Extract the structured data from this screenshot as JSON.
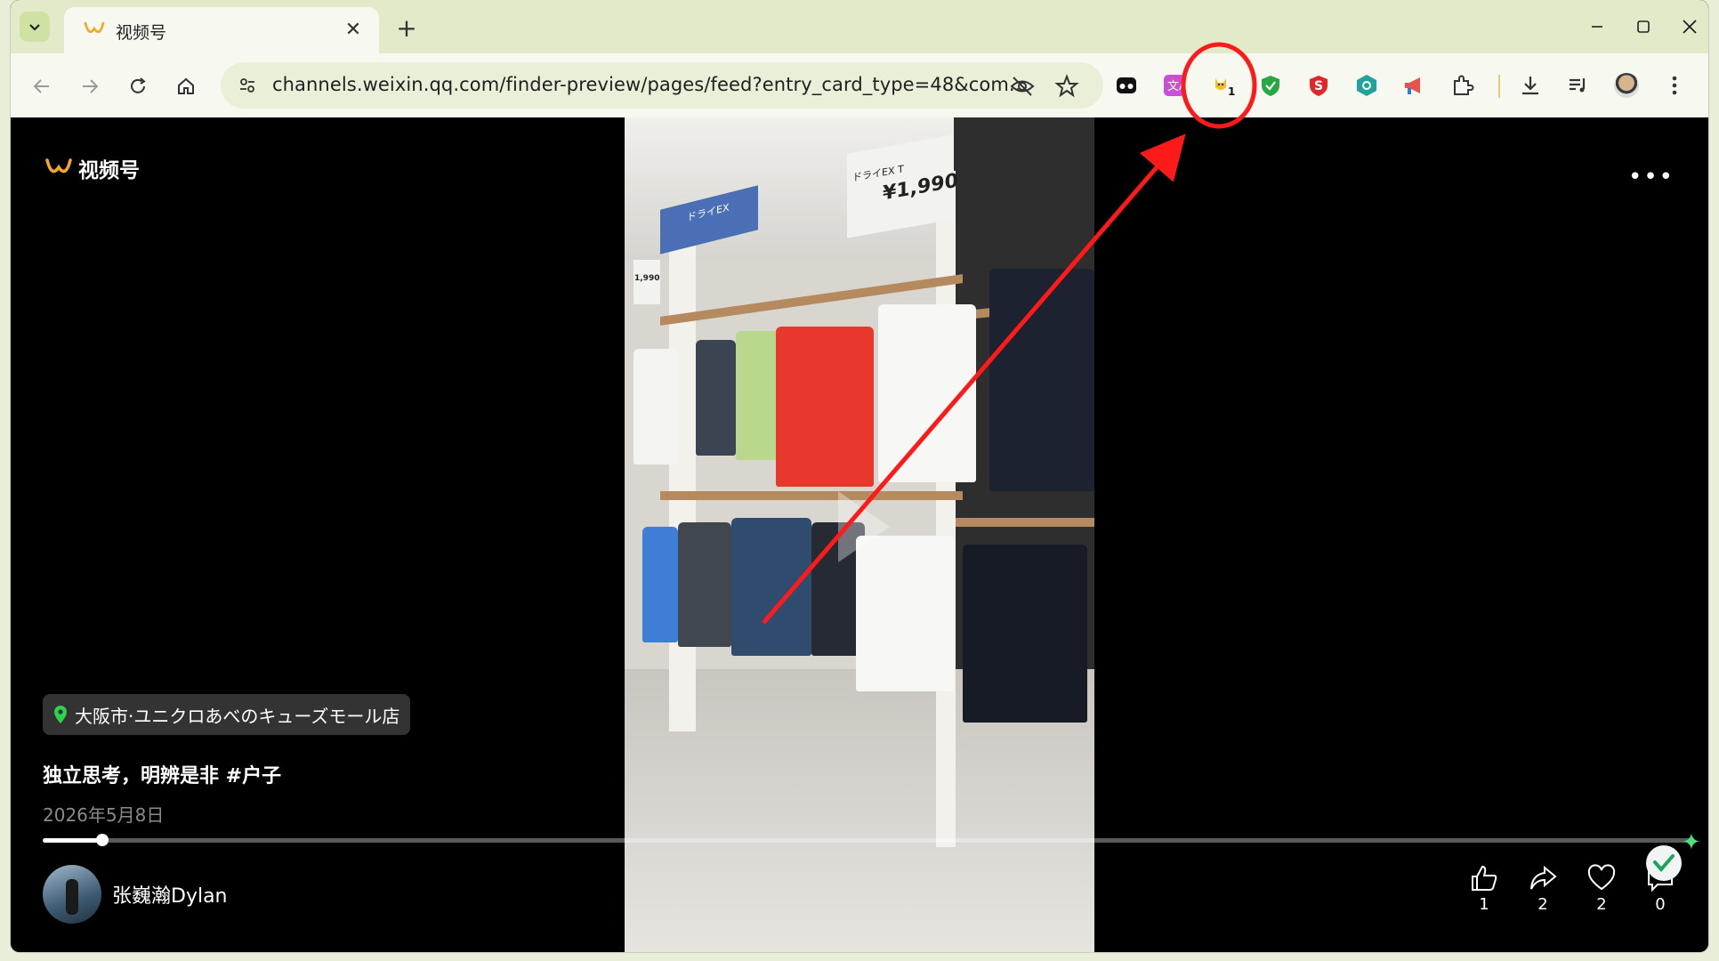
{
  "browser": {
    "tab_title": "视频号",
    "url": "channels.weixin.qq.com/finder-preview/pages/feed?entry_card_type=48&com...",
    "extension_badge": "1"
  },
  "page": {
    "brand": "视频号",
    "location": "大阪市·ユニクロあべのキューズモール店",
    "caption": "独立思考，明辨是非 #户子",
    "date": "2026年5月8日",
    "author": "张巍瀚Dylan",
    "progress": 0.036,
    "actions": {
      "like_count": "1",
      "share_count": "2",
      "favorite_count": "2",
      "comment_count": "0"
    },
    "video_signs": {
      "price_large": "¥1,990",
      "label_dry": "ドライEX T",
      "label_dry2": "ドライEX",
      "price_small": "1,990"
    }
  },
  "colors": {
    "brand_orange": "#f5a623",
    "annotation_red": "#ff1a1a",
    "location_pin": "#2fd34b"
  }
}
